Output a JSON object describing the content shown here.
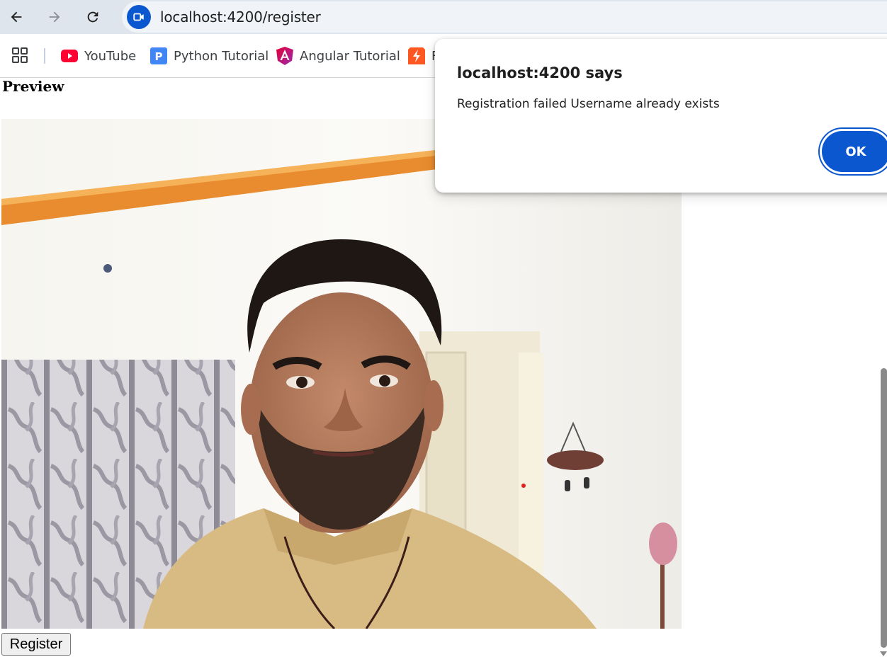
{
  "browser": {
    "url": "localhost:4200/register",
    "bookmarks": [
      {
        "label": "YouTube",
        "icon": "youtube-icon"
      },
      {
        "label": "Python Tutorial",
        "icon": "p-letter-icon"
      },
      {
        "label": "Angular Tutorial",
        "icon": "angular-icon"
      },
      {
        "label": "F",
        "icon": "lightning-icon"
      }
    ],
    "badge_letter": "P"
  },
  "page": {
    "heading": "Preview",
    "register_label": "Register"
  },
  "dialog": {
    "title": "localhost:4200 says",
    "message": "Registration failed Username already exists",
    "ok_label": "OK"
  },
  "colors": {
    "toolbar_bg": "#dfe5ed",
    "accent_blue": "#0b57d0",
    "youtube_red": "#ff0033",
    "angular_gradient": "#c3002f",
    "bookmark_orange": "#ff5722"
  }
}
